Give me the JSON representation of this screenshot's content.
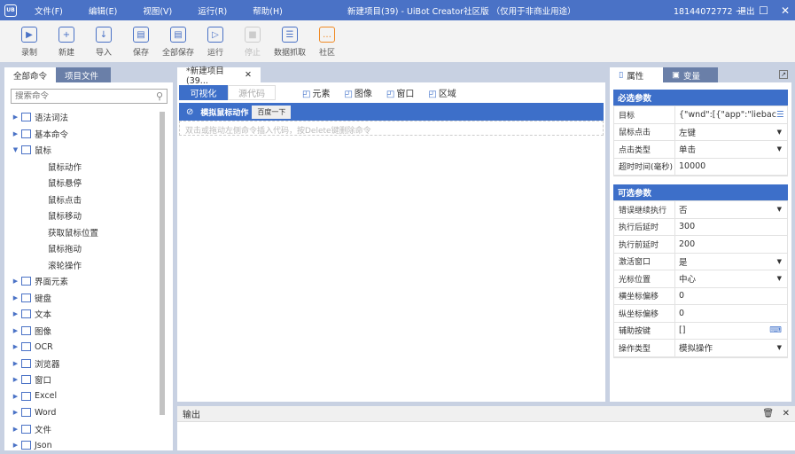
{
  "titlebar": {
    "logo": "UB",
    "menu": [
      "文件(F)",
      "编辑(E)",
      "视图(V)",
      "运行(R)",
      "帮助(H)"
    ],
    "title": "新建项目(39) - UiBot Creator社区版 （仅用于非商业用途）",
    "user": "18144072772",
    "logout": "退出"
  },
  "toolbar": [
    {
      "label": "录制",
      "icon": "record-icon"
    },
    {
      "label": "新建",
      "icon": "new-icon"
    },
    {
      "label": "导入",
      "icon": "import-icon"
    },
    {
      "label": "保存",
      "icon": "save-icon"
    },
    {
      "label": "全部保存",
      "icon": "save-all-icon"
    },
    {
      "label": "运行",
      "icon": "run-icon"
    },
    {
      "label": "停止",
      "icon": "stop-icon",
      "disabled": true
    },
    {
      "label": "数据抓取",
      "icon": "data-scrape-icon"
    },
    {
      "label": "社区",
      "icon": "community-icon"
    }
  ],
  "left": {
    "tabs": [
      "全部命令",
      "项目文件"
    ],
    "search_placeholder": "搜索命令",
    "tree": [
      {
        "label": "语法词法",
        "expanded": false
      },
      {
        "label": "基本命令",
        "expanded": false
      },
      {
        "label": "鼠标",
        "expanded": true,
        "children": [
          "鼠标动作",
          "鼠标悬停",
          "鼠标点击",
          "鼠标移动",
          "获取鼠标位置",
          "鼠标拖动",
          "滚轮操作"
        ]
      },
      {
        "label": "界面元素"
      },
      {
        "label": "键盘"
      },
      {
        "label": "文本"
      },
      {
        "label": "图像"
      },
      {
        "label": "OCR"
      },
      {
        "label": "浏览器"
      },
      {
        "label": "窗口"
      },
      {
        "label": "Excel"
      },
      {
        "label": "Word"
      },
      {
        "label": "文件"
      },
      {
        "label": "Json"
      }
    ]
  },
  "editor": {
    "tab": "*新建项目(39...",
    "views": [
      "可视化",
      "源代码"
    ],
    "tools": [
      "元素",
      "图像",
      "窗口",
      "区域"
    ],
    "block_title": "模拟鼠标动作",
    "block_button": "百度一下",
    "hint": "双击或拖动左侧命令插入代码，按Delete键删除命令"
  },
  "output": {
    "title": "输出"
  },
  "right": {
    "tabs": [
      "属性",
      "变量"
    ],
    "required_title": "必选参数",
    "required": [
      {
        "k": "目标",
        "v": "{\"wnd\":[{\"app\":\"liebac",
        "btn": true
      },
      {
        "k": "鼠标点击",
        "v": "左键",
        "dd": true
      },
      {
        "k": "点击类型",
        "v": "单击",
        "dd": true
      },
      {
        "k": "超时时间(毫秒)",
        "v": "10000"
      }
    ],
    "optional_title": "可选参数",
    "optional": [
      {
        "k": "错误继续执行",
        "v": "否",
        "dd": true
      },
      {
        "k": "执行后延时",
        "v": "300"
      },
      {
        "k": "执行前延时",
        "v": "200"
      },
      {
        "k": "激活窗口",
        "v": "是",
        "dd": true
      },
      {
        "k": "光标位置",
        "v": "中心",
        "dd": true
      },
      {
        "k": "横坐标偏移",
        "v": "0"
      },
      {
        "k": "纵坐标偏移",
        "v": "0"
      },
      {
        "k": "辅助按键",
        "v": "[]",
        "btn": true
      },
      {
        "k": "操作类型",
        "v": "模拟操作",
        "dd": true
      }
    ]
  }
}
